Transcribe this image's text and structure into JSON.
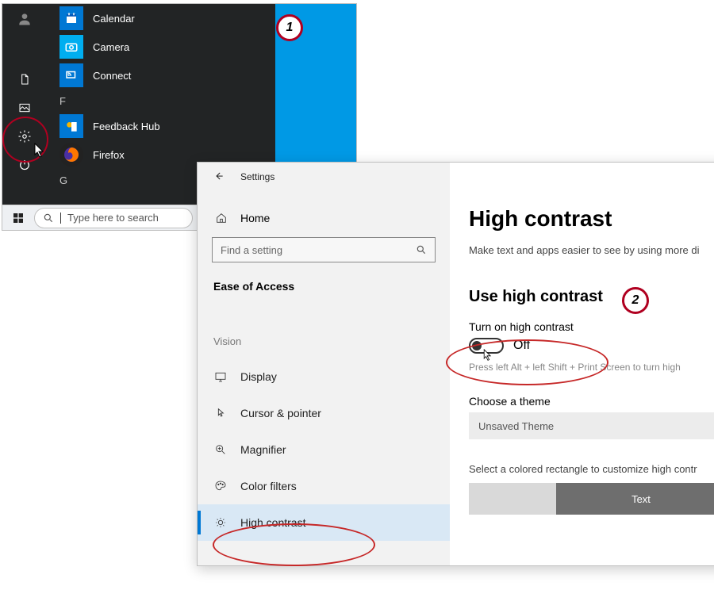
{
  "startmenu": {
    "apps": {
      "calendar": "Calendar",
      "camera": "Camera",
      "connect": "Connect",
      "feedback": "Feedback Hub",
      "firefox": "Firefox"
    },
    "letter_f": "F",
    "letter_g": "G",
    "search_placeholder": "Type here to search"
  },
  "badges": {
    "one": "1",
    "two": "2"
  },
  "settings": {
    "window_title": "Settings",
    "home": "Home",
    "search_placeholder": "Find a setting",
    "category": "Ease of Access",
    "vision_group": "Vision",
    "nav": {
      "display": "Display",
      "cursor": "Cursor & pointer",
      "magnifier": "Magnifier",
      "colorfilters": "Color filters",
      "highcontrast": "High contrast"
    },
    "page": {
      "title": "High contrast",
      "subtitle": "Make text and apps easier to see by using more di",
      "use_heading": "Use high contrast",
      "toggle_label": "Turn on high contrast",
      "toggle_value": "Off",
      "shortcut_hint": "Press left Alt + left Shift + Print Screen to turn high",
      "choose_theme": "Choose a theme",
      "theme_value": "Unsaved Theme",
      "customize_caption": "Select a colored rectangle to customize high contr",
      "swatch_text": "Text"
    }
  }
}
